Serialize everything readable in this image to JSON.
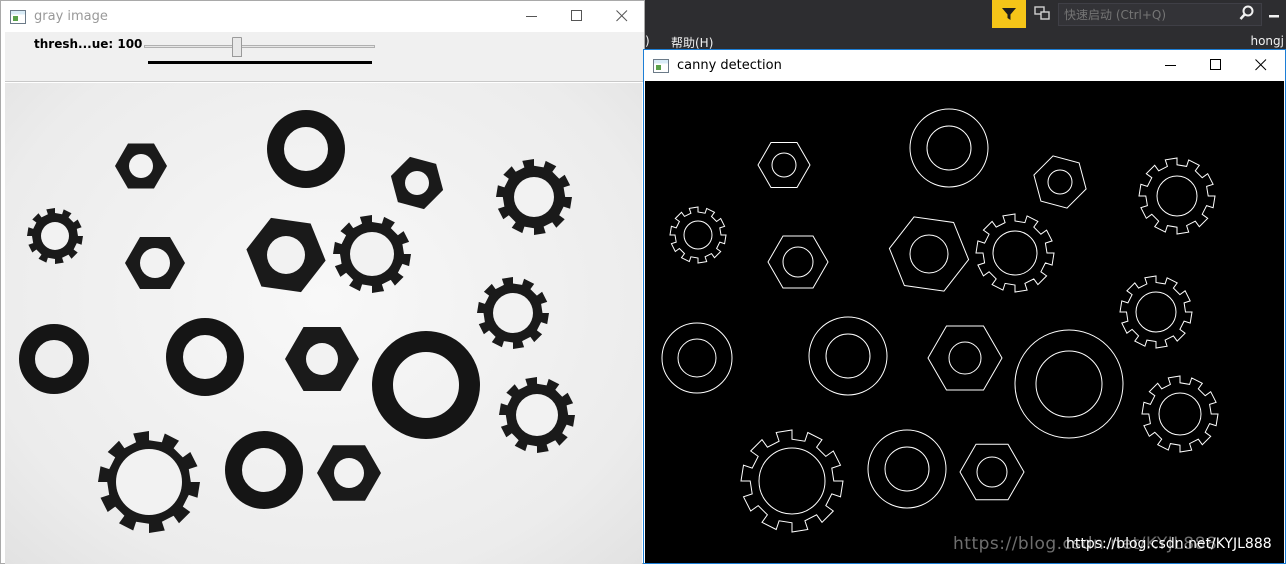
{
  "ide": {
    "menu_paren": ")",
    "menu_help": "帮助(H)",
    "user": "hongj",
    "quick_launch_placeholder": "快速启动 (Ctrl+Q)"
  },
  "gray_window": {
    "title": "gray image",
    "trackbar": {
      "label": "thresh...ue: 100",
      "value": 100
    }
  },
  "canny_window": {
    "title": "canny detection"
  },
  "watermark": "https://blog.csdn.net/KYJL888",
  "colors": {
    "accent": "#1c7ed6",
    "filter": "#f5c518"
  }
}
